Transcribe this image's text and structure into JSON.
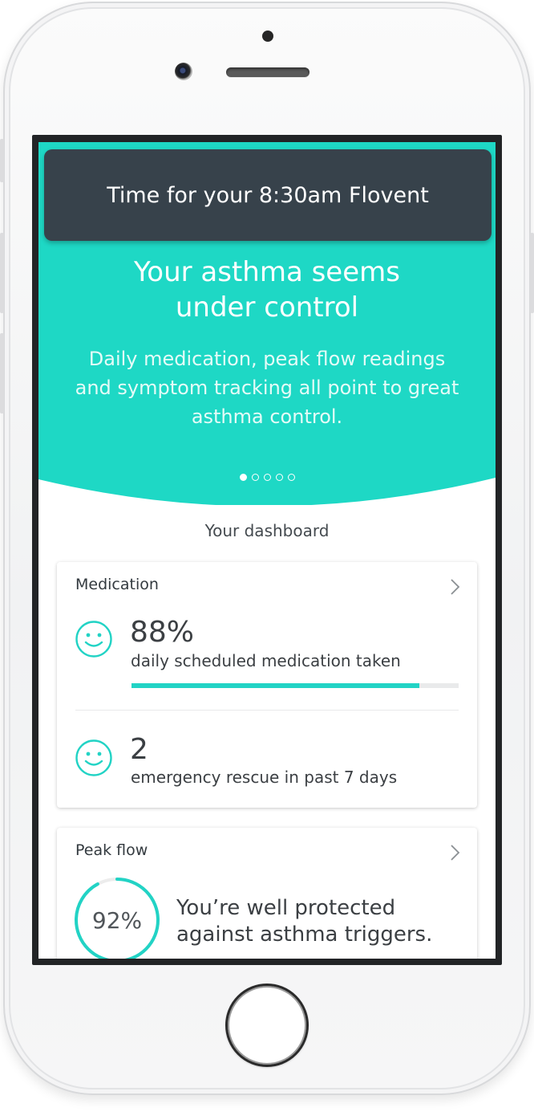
{
  "notification": {
    "text": "Time for your 8:30am Flovent"
  },
  "hero": {
    "title": "Your asthma seems under control",
    "subtitle": "Daily medication, peak flow readings and symptom tracking all point to great asthma control.",
    "page_count": 5,
    "active_page": 1,
    "color": "#1ed8c5"
  },
  "dashboard": {
    "title": "Your dashboard",
    "medication": {
      "title": "Medication",
      "taken": {
        "value": "88%",
        "label": "daily scheduled medication taken",
        "progress": 0.88
      },
      "rescue": {
        "value": "2",
        "label": "emergency rescue in past 7 days"
      },
      "status_icon": "smiley-icon"
    },
    "peak_flow": {
      "title": "Peak flow",
      "percent_label": "92%",
      "percent": 0.92,
      "message": "You’re well protected against asthma triggers."
    }
  },
  "colors": {
    "accent": "#22d3c5",
    "toast_bg": "#37424b"
  }
}
